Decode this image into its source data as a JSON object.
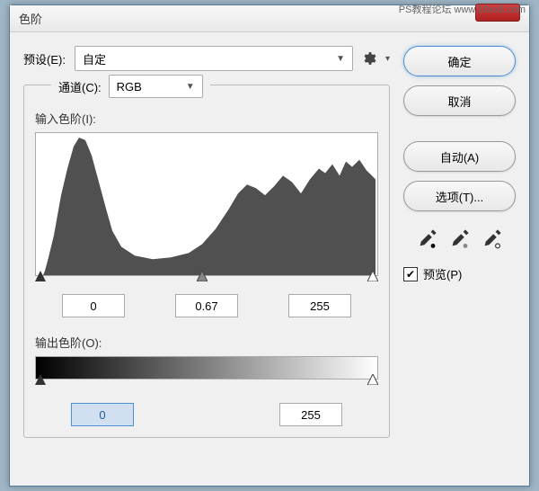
{
  "window": {
    "title": "色阶",
    "watermark": "PS教程论坛    www.16xx8.com"
  },
  "preset": {
    "label": "预设(E):",
    "value": "自定"
  },
  "channel": {
    "label": "通道(C):",
    "value": "RGB"
  },
  "input_levels": {
    "label": "输入色阶(I):",
    "black": "0",
    "gamma": "0.67",
    "white": "255"
  },
  "output_levels": {
    "label": "输出色阶(O):",
    "black": "0",
    "white": "255"
  },
  "buttons": {
    "ok": "确定",
    "cancel": "取消",
    "auto": "自动(A)",
    "options": "选项(T)..."
  },
  "preview": {
    "label": "预览(P)",
    "checked": true
  }
}
